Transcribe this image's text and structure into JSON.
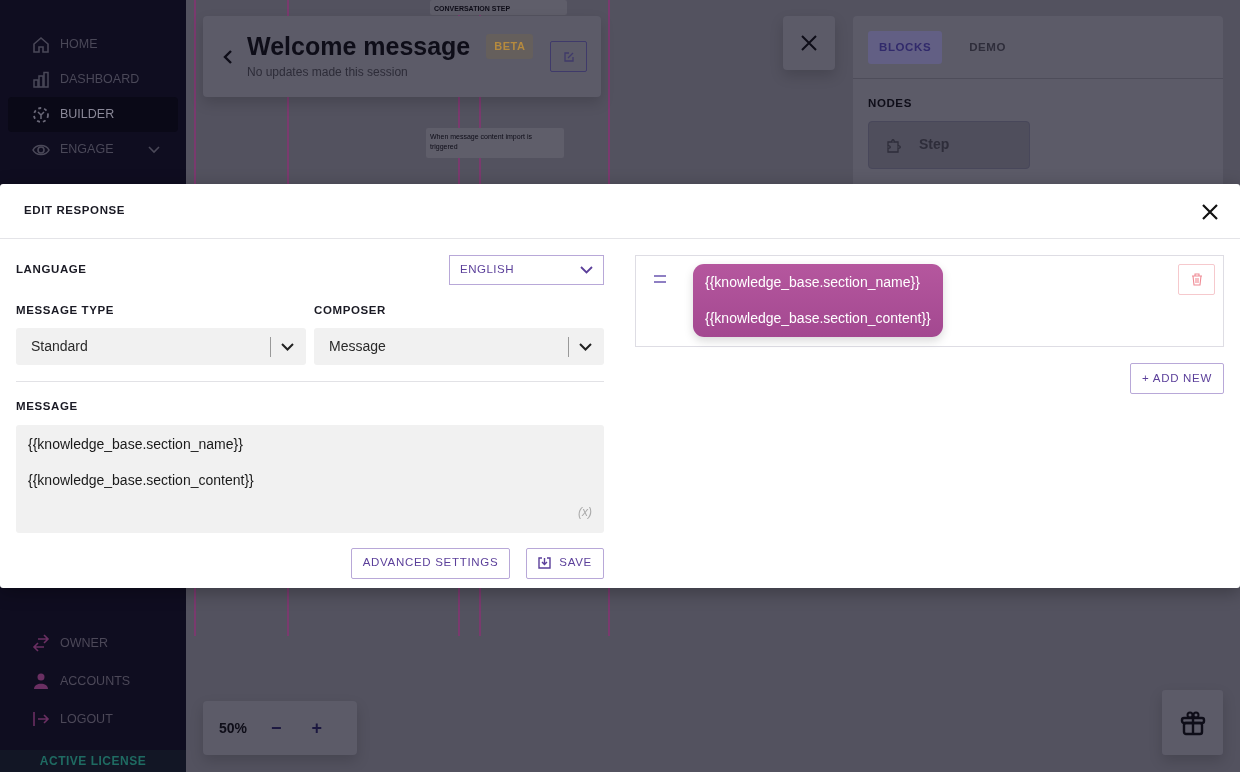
{
  "sidebar": {
    "items": [
      {
        "label": "HOME",
        "kind": "link",
        "selected": false
      },
      {
        "label": "DASHBOARD",
        "kind": "link",
        "selected": false
      },
      {
        "label": "BUILDER",
        "kind": "link",
        "selected": true
      },
      {
        "label": "ENGAGE",
        "kind": "group",
        "selected": false
      }
    ],
    "bottom_items": [
      {
        "label": "OWNER"
      },
      {
        "label": "ACCOUNTS"
      },
      {
        "label": "LOGOUT"
      }
    ],
    "license": "ACTIVE LICENSE"
  },
  "flow_header": {
    "title": "Welcome message",
    "badge": "BETA",
    "subtitle": "No updates made this session"
  },
  "canvas_nodes": [
    {
      "kind": "step",
      "text": "CONVERSATION STEP"
    },
    {
      "kind": "trigger",
      "text": "When message content import is triggered"
    }
  ],
  "side_panel": {
    "tabs": [
      {
        "label": "BLOCKS",
        "selected": true
      },
      {
        "label": "DEMO",
        "selected": false
      }
    ],
    "section": "NODES",
    "nodes": [
      {
        "label": "Step"
      }
    ]
  },
  "zoom": {
    "value": "50%",
    "minus": "−",
    "plus": "+"
  },
  "modal": {
    "title": "EDIT RESPONSE",
    "language": {
      "label": "LANGUAGE",
      "value": "ENGLISH"
    },
    "message_type": {
      "label": "MESSAGE TYPE",
      "value": "Standard"
    },
    "composer": {
      "label": "COMPOSER",
      "value": "Message"
    },
    "message": {
      "label": "MESSAGE",
      "value": "{{knowledge_base.section_name}}\n\n{{knowledge_base.section_content}}",
      "variable_button": "(x)"
    },
    "buttons": [
      "ADVANCED SETTINGS",
      "SAVE"
    ],
    "responses": [
      {
        "text": "{{knowledge_base.section_name}}\n\n{{knowledge_base.section_content}}"
      }
    ],
    "add_new": "+ ADD NEW"
  }
}
